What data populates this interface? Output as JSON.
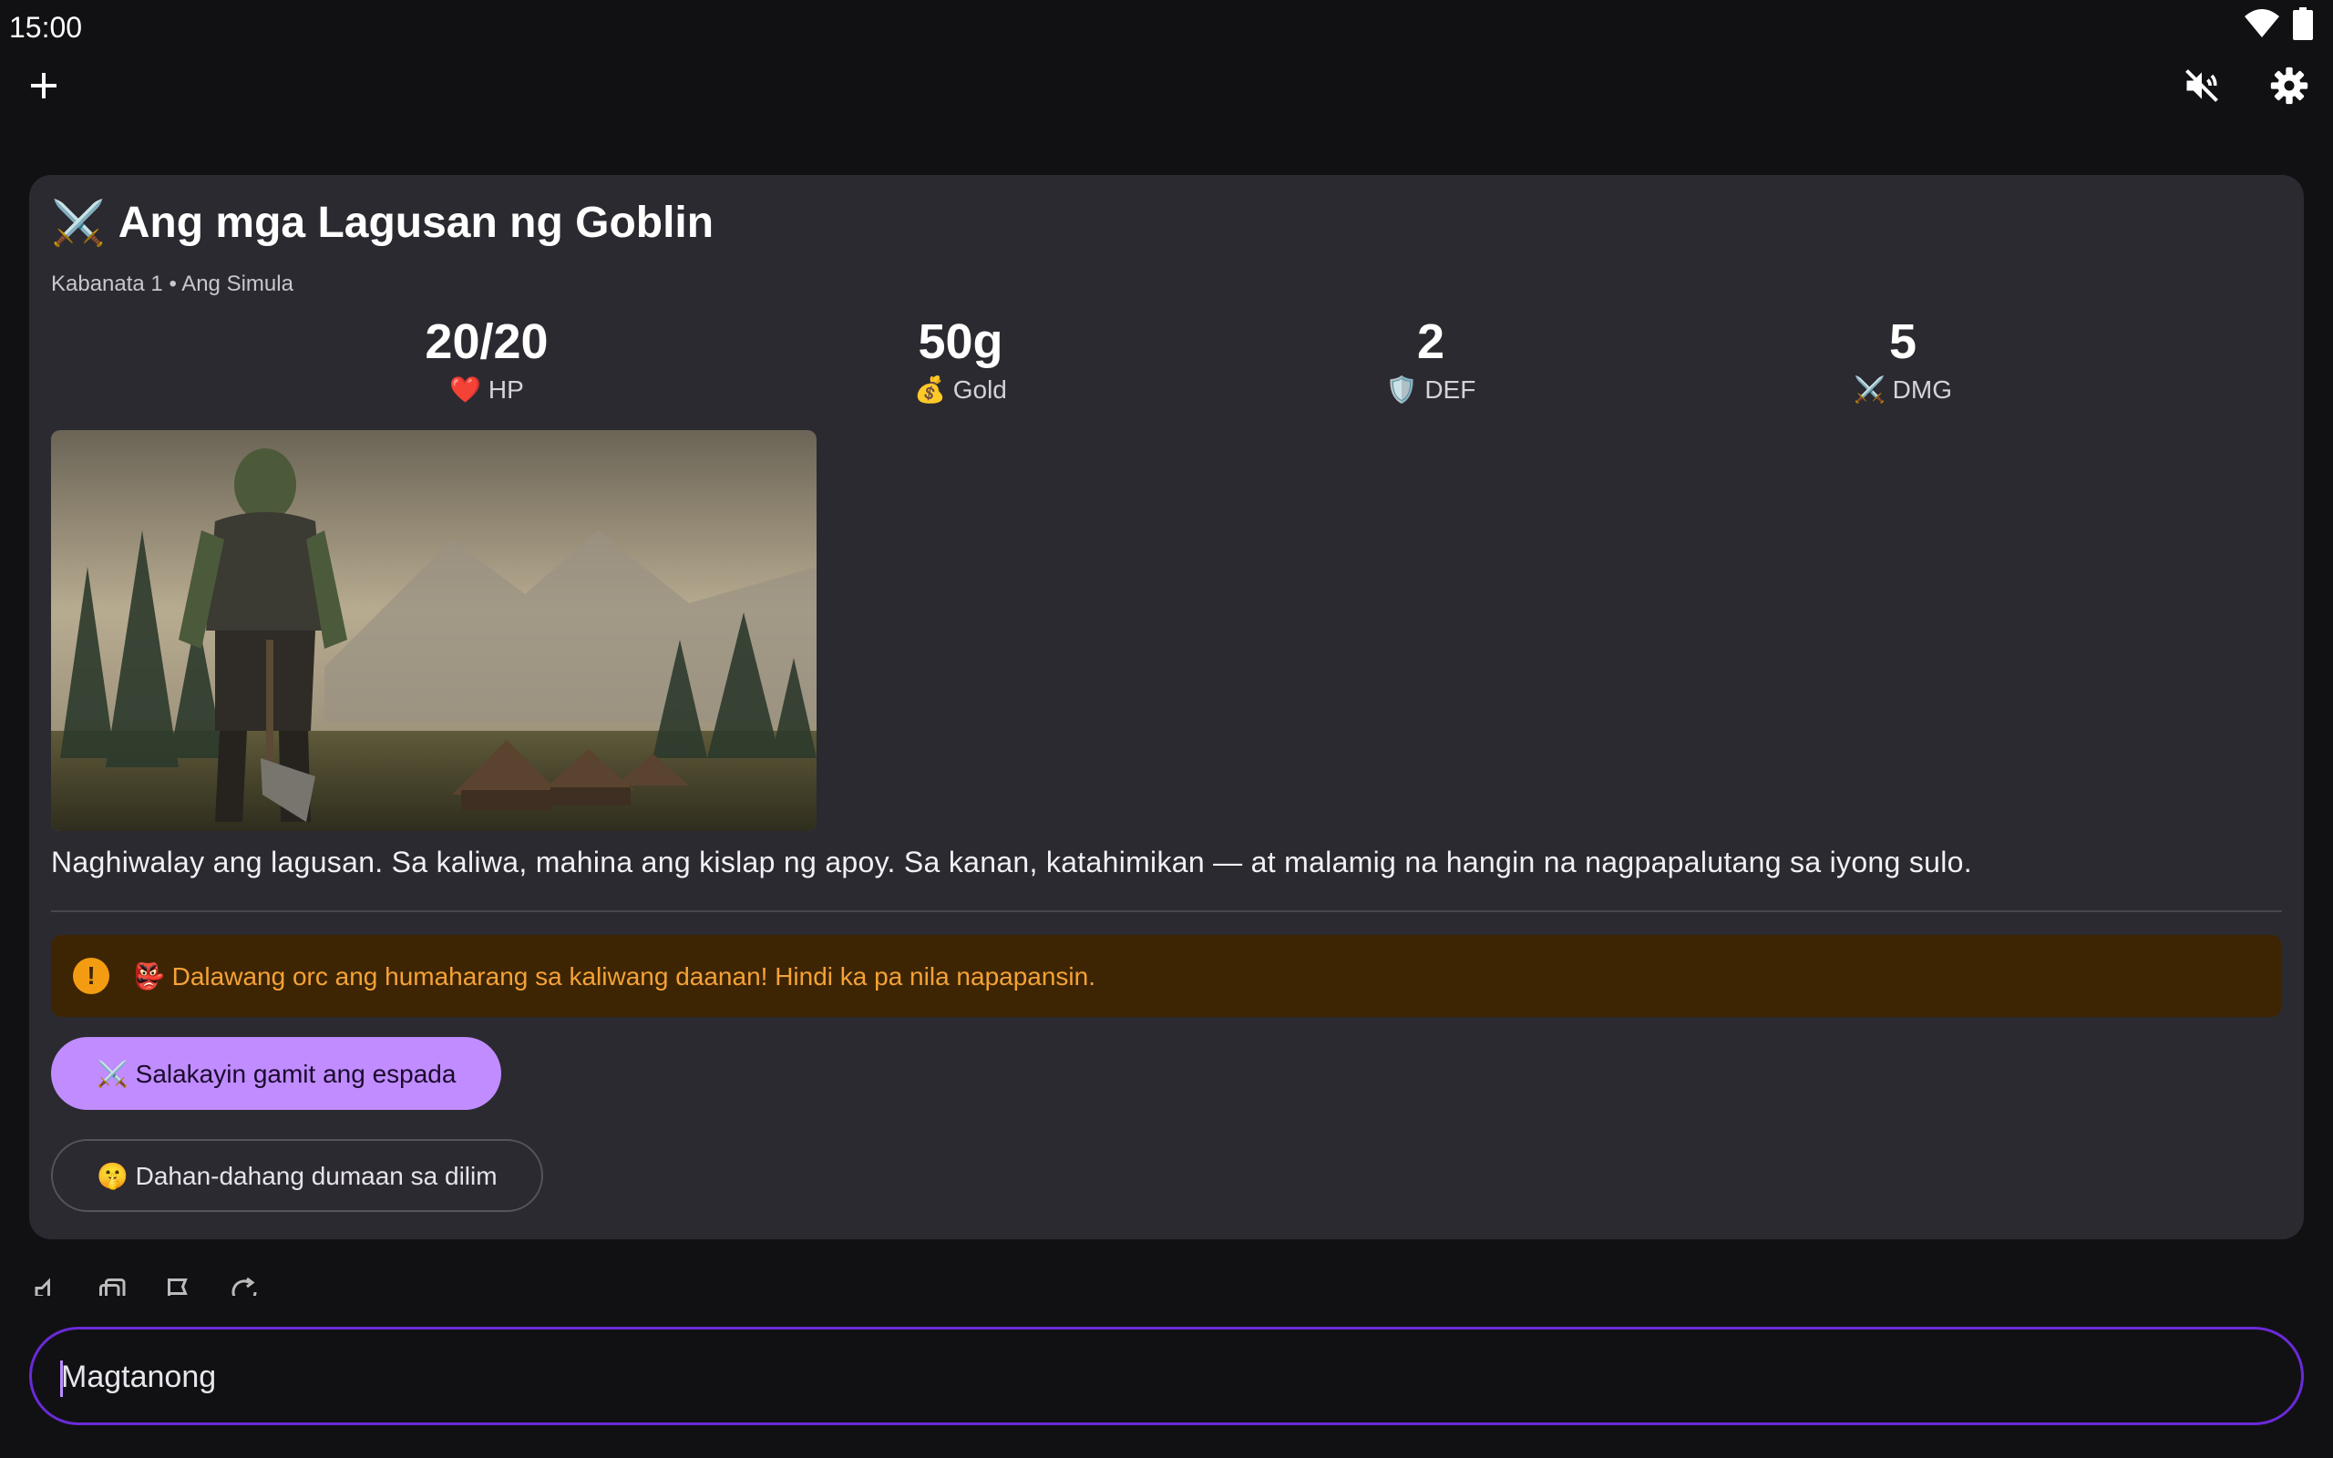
{
  "status_bar": {
    "time": "15:00",
    "icons": [
      "wifi-icon",
      "battery-icon"
    ]
  },
  "top_bar": {
    "left_icon": "plus-icon",
    "right_icons": [
      "volume-off-icon",
      "gear-icon"
    ]
  },
  "quest": {
    "title_emoji": "⚔️",
    "title": "Ang mga Lagusan ng Goblin",
    "subtitle": "Kabanata 1 • Ang Simula"
  },
  "stats": [
    {
      "value": "20/20",
      "label": "❤️ HP"
    },
    {
      "value": "50g",
      "label": "💰 Gold"
    },
    {
      "value": "2",
      "label": "🛡️ DEF"
    },
    {
      "value": "5",
      "label": "⚔️ DMG"
    }
  ],
  "scene_image": {
    "subject": "orc-warrior-village-illustration"
  },
  "narration": "Naghiwalay ang lagusan. Sa kaliwa, mahina ang kislap ng apoy. Sa kanan, katahimikan — at malamig na hangin na nagpapalutang sa iyong sulo.",
  "alert": {
    "icon": "!",
    "text": "👺 Dalawang orc ang humaharang sa kaliwang daanan! Hindi ka pa nila napapansin."
  },
  "choices": [
    {
      "label": "⚔️ Salakayin gamit ang espada"
    },
    {
      "label": "🤫 Dahan-dahang dumaan sa dilim"
    }
  ],
  "message_actions": [
    "volume-icon",
    "copy-icon",
    "flag-icon",
    "refresh-icon"
  ],
  "composer": {
    "placeholder": "Magtanong",
    "value": ""
  },
  "colors": {
    "background": "#111113",
    "card": "#2b2a30",
    "accent": "#c08cff",
    "composer_border": "#6a2ad8",
    "alert_bg": "#3d2503",
    "alert_text": "#f5a237"
  }
}
